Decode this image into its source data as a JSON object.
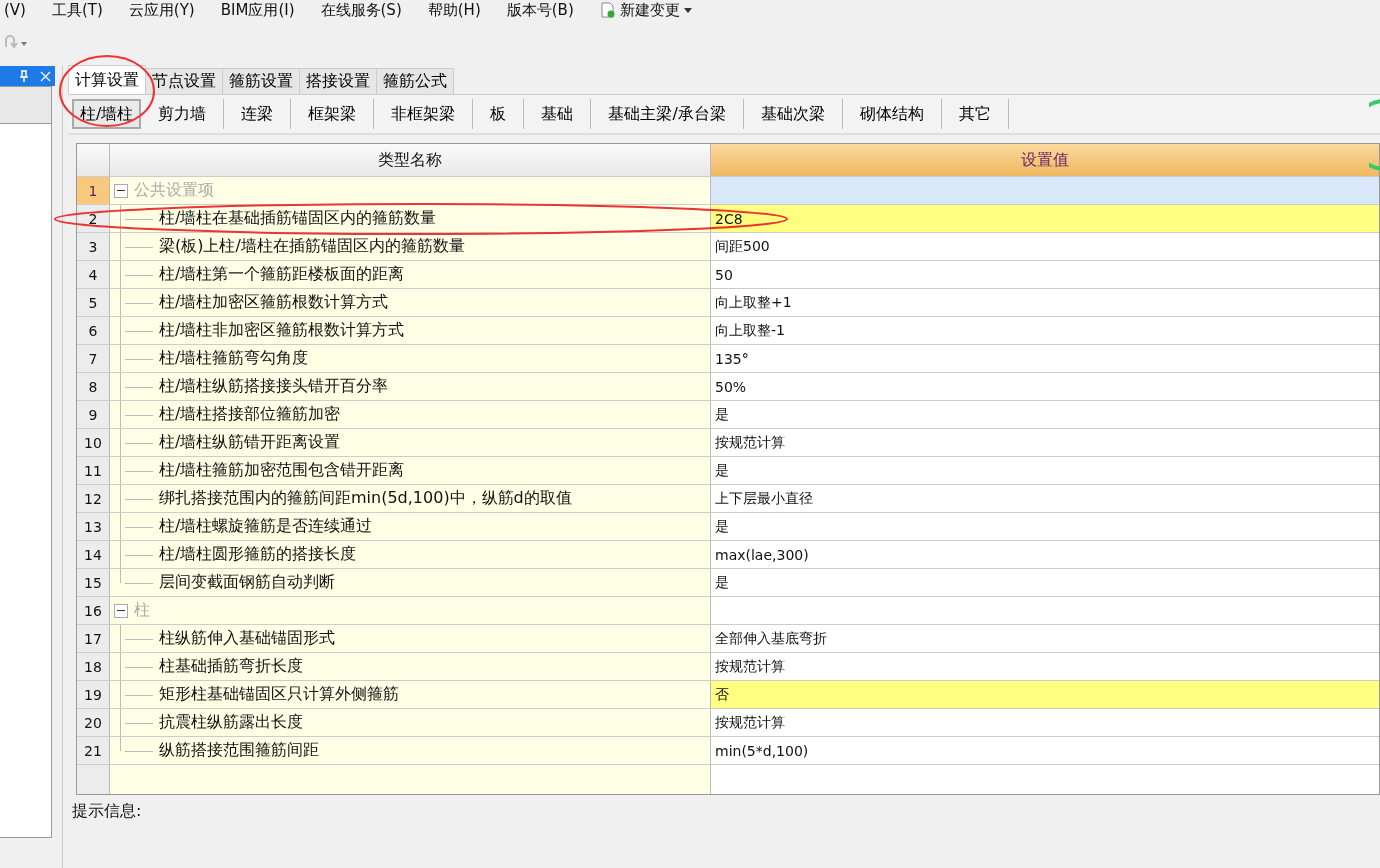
{
  "menu_bar": [
    {
      "label": "(V)"
    },
    {
      "label": "工具(T)"
    },
    {
      "label": "云应用(Y)"
    },
    {
      "label": "BIM应用(I)"
    },
    {
      "label": "在线服务(S)"
    },
    {
      "label": "帮助(H)"
    },
    {
      "label": "版本号(B)"
    },
    {
      "label": "新建变更",
      "kind": "dropdown"
    }
  ],
  "tabs": [
    {
      "label": "计算设置",
      "selected": true
    },
    {
      "label": "节点设置",
      "selected": false
    },
    {
      "label": "箍筋设置",
      "selected": false
    },
    {
      "label": "搭接设置",
      "selected": false
    },
    {
      "label": "箍筋公式",
      "selected": false
    }
  ],
  "sub_tabs": [
    {
      "label": "柱/墙柱",
      "selected": true
    },
    {
      "label": "剪力墙",
      "selected": false
    },
    {
      "label": "连梁",
      "selected": false
    },
    {
      "label": "框架梁",
      "selected": false
    },
    {
      "label": "非框架梁",
      "selected": false
    },
    {
      "label": "板",
      "selected": false
    },
    {
      "label": "基础",
      "selected": false
    },
    {
      "label": "基础主梁/承台梁",
      "selected": false
    },
    {
      "label": "基础次梁",
      "selected": false
    },
    {
      "label": "砌体结构",
      "selected": false
    },
    {
      "label": "其它",
      "selected": false
    }
  ],
  "table": {
    "columns": [
      "类型名称",
      "设置值"
    ],
    "groups": [
      {
        "number": "1",
        "name": "公共设置项",
        "expanded": true,
        "selected": true,
        "children": [
          {
            "number": "2",
            "name": "柱/墙柱在基础插筋锚固区内的箍筋数量",
            "value": "2C8",
            "highlighted": true
          },
          {
            "number": "3",
            "name": "梁(板)上柱/墙柱在插筋锚固区内的箍筋数量",
            "value": "间距500",
            "highlighted": false
          },
          {
            "number": "4",
            "name": "柱/墙柱第一个箍筋距楼板面的距离",
            "value": "50",
            "highlighted": false
          },
          {
            "number": "5",
            "name": "柱/墙柱加密区箍筋根数计算方式",
            "value": "向上取整+1",
            "highlighted": false
          },
          {
            "number": "6",
            "name": "柱/墙柱非加密区箍筋根数计算方式",
            "value": "向上取整-1",
            "highlighted": false
          },
          {
            "number": "7",
            "name": "柱/墙柱箍筋弯勾角度",
            "value": "135°",
            "highlighted": false
          },
          {
            "number": "8",
            "name": "柱/墙柱纵筋搭接接头错开百分率",
            "value": "50%",
            "highlighted": false
          },
          {
            "number": "9",
            "name": "柱/墙柱搭接部位箍筋加密",
            "value": "是",
            "highlighted": false
          },
          {
            "number": "10",
            "name": "柱/墙柱纵筋错开距离设置",
            "value": "按规范计算",
            "highlighted": false
          },
          {
            "number": "11",
            "name": "柱/墙柱箍筋加密范围包含错开距离",
            "value": "是",
            "highlighted": false
          },
          {
            "number": "12",
            "name": "绑扎搭接范围内的箍筋间距min(5d,100)中，纵筋d的取值",
            "value": "上下层最小直径",
            "highlighted": false
          },
          {
            "number": "13",
            "name": "柱/墙柱螺旋箍筋是否连续通过",
            "value": "是",
            "highlighted": false
          },
          {
            "number": "14",
            "name": "柱/墙柱圆形箍筋的搭接长度",
            "value": "max(lae,300)",
            "highlighted": false
          },
          {
            "number": "15",
            "name": "层间变截面钢筋自动判断",
            "value": "是",
            "highlighted": false
          }
        ]
      },
      {
        "number": "16",
        "name": "柱",
        "expanded": true,
        "selected": false,
        "children": [
          {
            "number": "17",
            "name": "柱纵筋伸入基础锚固形式",
            "value": "全部伸入基底弯折",
            "highlighted": false
          },
          {
            "number": "18",
            "name": "柱基础插筋弯折长度",
            "value": "按规范计算",
            "highlighted": false
          },
          {
            "number": "19",
            "name": "矩形柱基础锚固区只计算外侧箍筋",
            "value": "否",
            "highlighted": true
          },
          {
            "number": "20",
            "name": "抗震柱纵筋露出长度",
            "value": "按规范计算",
            "highlighted": false
          },
          {
            "number": "21",
            "name": "纵筋搭接范围箍筋间距",
            "value": "min(5*d,100)",
            "highlighted": false
          }
        ]
      }
    ]
  },
  "hint": {
    "label": "提示信息:"
  }
}
